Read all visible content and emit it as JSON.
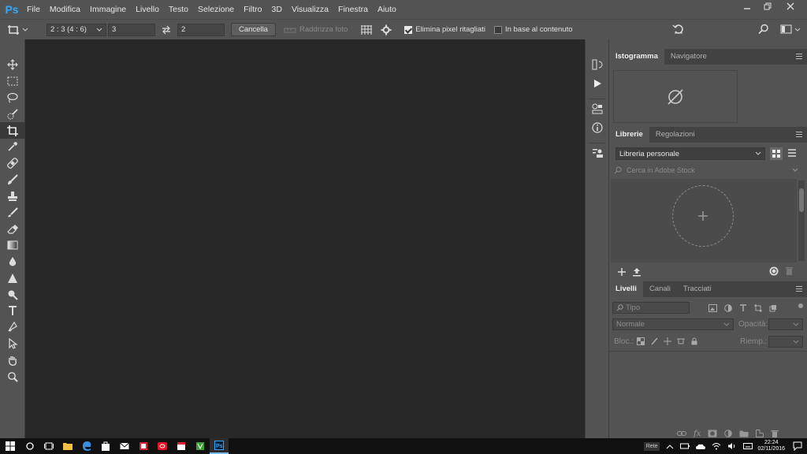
{
  "app": {
    "logo": "Ps"
  },
  "menu": [
    "File",
    "Modifica",
    "Immagine",
    "Livello",
    "Testo",
    "Selezione",
    "Filtro",
    "3D",
    "Visualizza",
    "Finestra",
    "Aiuto"
  ],
  "options": {
    "ratio": "2 : 3 (4 : 6)",
    "width_value": "3",
    "height_value": "2",
    "cancel_label": "Cancella",
    "straighten_label": "Raddrizza foto",
    "delete_cropped_label": "Elimina pixel ritagliati",
    "content_aware_label": "In base al contenuto"
  },
  "panels": {
    "histogram": {
      "tabs": [
        "Istogramma",
        "Navigatore"
      ]
    },
    "libraries": {
      "tabs": [
        "Librerie",
        "Regolazioni"
      ],
      "library_select": "Libreria personale",
      "search_placeholder": "Cerca in Adobe Stock"
    },
    "layers": {
      "tabs": [
        "Livelli",
        "Canali",
        "Tracciati"
      ],
      "filter_placeholder": "Tipo",
      "blend_mode": "Normale",
      "opacity_label": "Opacità:",
      "lock_label": "Bloc.:",
      "fill_label": "Riemp.:"
    }
  },
  "taskbar": {
    "lang": "Rete",
    "time": "22:24",
    "date": "02/11/2016"
  },
  "colors": {
    "accent": "#31a8ff",
    "panel": "#535353",
    "canvas": "#282828"
  }
}
